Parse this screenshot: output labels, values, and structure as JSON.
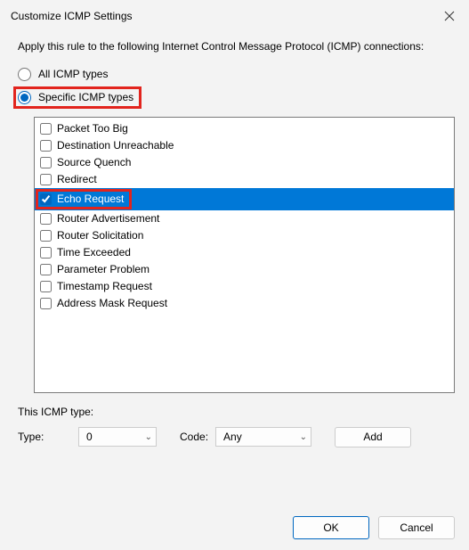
{
  "titlebar": {
    "title": "Customize ICMP Settings"
  },
  "instructions": "Apply this rule to the following Internet Control Message Protocol (ICMP) connections:",
  "radios": {
    "all": {
      "label": "All ICMP types",
      "checked": false
    },
    "specific": {
      "label": "Specific ICMP types",
      "checked": true
    }
  },
  "icmp_types": [
    {
      "label": "Packet Too Big",
      "checked": false,
      "selected": false
    },
    {
      "label": "Destination Unreachable",
      "checked": false,
      "selected": false
    },
    {
      "label": "Source Quench",
      "checked": false,
      "selected": false
    },
    {
      "label": "Redirect",
      "checked": false,
      "selected": false
    },
    {
      "label": "Echo Request",
      "checked": true,
      "selected": true
    },
    {
      "label": "Router Advertisement",
      "checked": false,
      "selected": false
    },
    {
      "label": "Router Solicitation",
      "checked": false,
      "selected": false
    },
    {
      "label": "Time Exceeded",
      "checked": false,
      "selected": false
    },
    {
      "label": "Parameter Problem",
      "checked": false,
      "selected": false
    },
    {
      "label": "Timestamp Request",
      "checked": false,
      "selected": false
    },
    {
      "label": "Address Mask Request",
      "checked": false,
      "selected": false
    }
  ],
  "section_label": "This ICMP type:",
  "type_row": {
    "type_label": "Type:",
    "type_value": "0",
    "code_label": "Code:",
    "code_value": "Any",
    "add_label": "Add"
  },
  "footer": {
    "ok": "OK",
    "cancel": "Cancel"
  }
}
